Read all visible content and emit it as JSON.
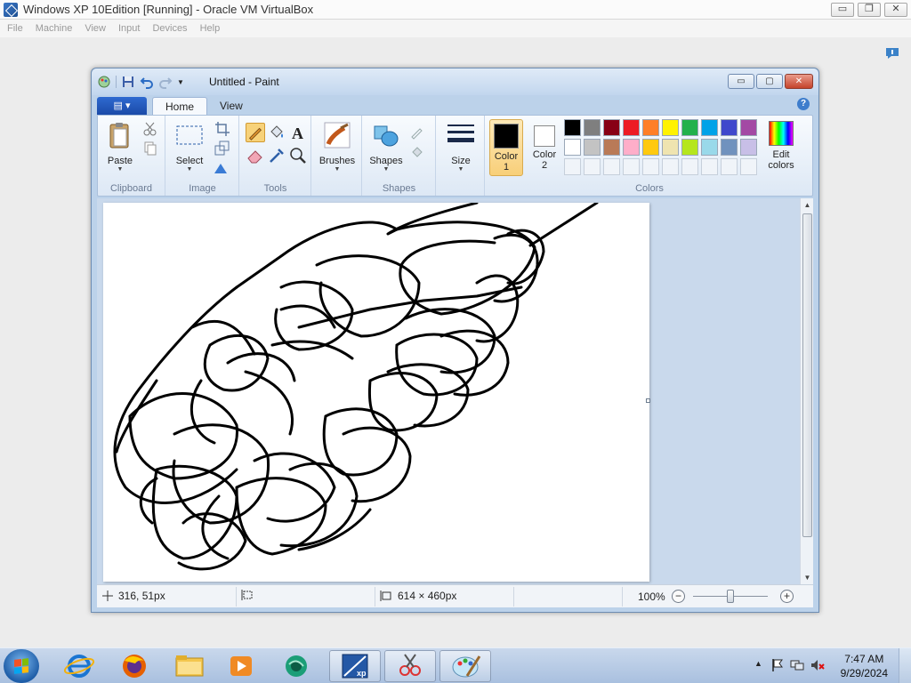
{
  "host": {
    "title": "Windows XP 10Edition [Running] - Oracle VM VirtualBox",
    "menu": [
      "File",
      "Machine",
      "View",
      "Input",
      "Devices",
      "Help"
    ],
    "window_buttons": {
      "minimize": "▭",
      "restore": "❐",
      "close": "✕"
    }
  },
  "paint": {
    "title": "Untitled - Paint",
    "quick_access": {
      "dropdown": "▼"
    },
    "app_menu_label": "▤ ▾",
    "tabs": [
      {
        "label": "Home",
        "active": true
      },
      {
        "label": "View",
        "active": false
      }
    ],
    "help": "?",
    "window_buttons": {
      "minimize": "▭",
      "maximize": "▢",
      "close": "✕"
    },
    "groups": {
      "clipboard": {
        "label": "Clipboard",
        "paste": "Paste"
      },
      "image": {
        "label": "Image",
        "select": "Select"
      },
      "tools": {
        "label": "Tools"
      },
      "brushes": {
        "label": "Brushes"
      },
      "shapes": {
        "label": "Shapes",
        "shapes_button": "Shapes"
      },
      "size": {
        "label": "Size"
      },
      "colors": {
        "label": "Colors",
        "color1_label": "Color",
        "color1_num": "1",
        "color2_label": "Color",
        "color2_num": "2",
        "edit_label": "Edit",
        "edit_label2": "colors",
        "color1_value": "#000000",
        "color2_value": "#ffffff",
        "palette": [
          "#000000",
          "#7f7f7f",
          "#880015",
          "#ed1c24",
          "#ff7f27",
          "#fff200",
          "#22b14c",
          "#00a2e8",
          "#3f48cc",
          "#a349a4",
          "#ffffff",
          "#c3c3c3",
          "#b97a57",
          "#ffaec9",
          "#ffc90e",
          "#efe4b0",
          "#b5e61d",
          "#99d9ea",
          "#7092be",
          "#c8bfe7"
        ],
        "custom_slots": 10
      }
    },
    "status": {
      "cursor_pos": "316, 51px",
      "selection_size": "",
      "canvas_size": "614 × 460px",
      "zoom": "100%",
      "zoom_level": 0.5
    }
  },
  "taskbar": {
    "pinned": [
      "internet-explorer-icon",
      "firefox-icon",
      "windows-explorer-icon",
      "media-player-icon",
      "edge-like-icon"
    ],
    "running": [
      "xp-virtualbox-icon",
      "snipping-tool-icon",
      "paint-icon"
    ],
    "clock": {
      "time": "7:47 AM",
      "date": "9/29/2024"
    },
    "tray_chevron": "▲"
  }
}
